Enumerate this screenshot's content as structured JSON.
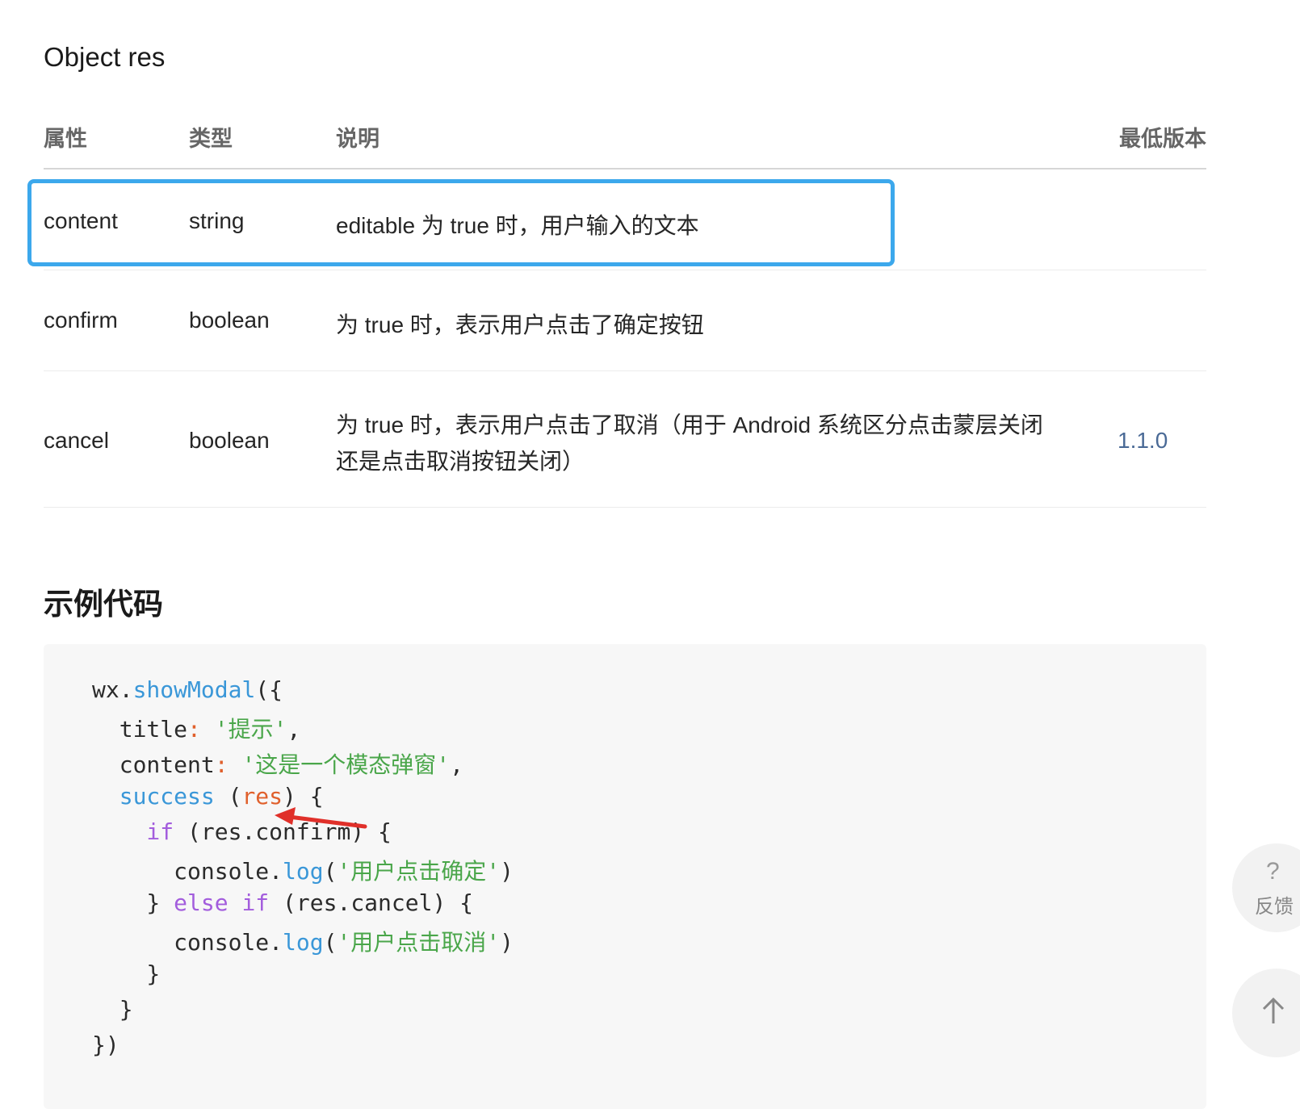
{
  "section": {
    "title": "Object res"
  },
  "table": {
    "headers": [
      "属性",
      "类型",
      "说明",
      "最低版本"
    ],
    "rows": [
      {
        "name": "content",
        "type": "string",
        "desc": "editable 为 true 时，用户输入的文本",
        "version": ""
      },
      {
        "name": "confirm",
        "type": "boolean",
        "desc": "为 true 时，表示用户点击了确定按钮",
        "version": ""
      },
      {
        "name": "cancel",
        "type": "boolean",
        "desc_line1": "为 true 时，表示用户点击了取消（用于 Android 系统区分点击蒙层关闭",
        "desc_line2": "还是点击取消按钮关闭）",
        "version": "1.1.0"
      }
    ]
  },
  "example": {
    "title": "示例代码",
    "code": {
      "l1_obj": "wx.",
      "l1_fn": "showModal",
      "l1_end": "({",
      "l2_key": "  title",
      "l2_colon": ":",
      "l2_str": "'提示'",
      "l2_end": ",",
      "l3_key": "  content",
      "l3_colon": ":",
      "l3_str": "'这是一个模态弹窗'",
      "l3_end": ",",
      "l4_kw": "  success",
      "l4_open": " (",
      "l4_param": "res",
      "l4_end": ") {",
      "l5_kw": "    if",
      "l5_rest": " (res.confirm) {",
      "l6_obj": "      console.",
      "l6_fn": "log",
      "l6_open": "(",
      "l6_str": "'用户点击确定'",
      "l6_close": ")",
      "l7_brace": "    } ",
      "l7_kw": "else if",
      "l7_rest": " (res.cancel) {",
      "l8_obj": "      console.",
      "l8_fn": "log",
      "l8_open": "(",
      "l8_str": "'用户点击取消'",
      "l8_close": ")",
      "l9": "    }",
      "l10": "  }",
      "l11": "})"
    }
  },
  "floating": {
    "feedback_icon": "?",
    "feedback_label": "反馈",
    "top_icon": "arrow-up-icon"
  },
  "colors": {
    "highlight": "#3ca8ec",
    "annotation_arrow": "#e0302a",
    "link": "#4a6a96"
  }
}
